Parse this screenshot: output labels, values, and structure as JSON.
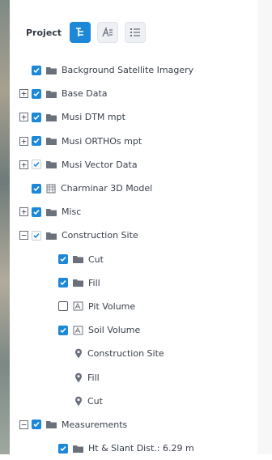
{
  "toolbar": {
    "title": "Project",
    "buttons": [
      {
        "icon": "layer-tree-icon",
        "active": true
      },
      {
        "icon": "legend-icon",
        "active": false
      },
      {
        "icon": "list-icon",
        "active": false
      }
    ]
  },
  "colors": {
    "accent": "#1e88d8",
    "folder": "#6b717b",
    "text": "#3a404b"
  },
  "tree": [
    {
      "label": "Background Satellite Imagery"
    },
    {
      "label": "Base Data"
    },
    {
      "label": "Musi DTM mpt"
    },
    {
      "label": "Musi ORTHOs mpt"
    },
    {
      "label": "Musi Vector Data"
    },
    {
      "label": "Charminar 3D Model"
    },
    {
      "label": "Misc"
    },
    {
      "label": "Construction Site"
    },
    {
      "label": "Cut"
    },
    {
      "label": "Fill"
    },
    {
      "label": "Pit Volume"
    },
    {
      "label": "Soil Volume"
    },
    {
      "label": "Construction Site"
    },
    {
      "label": "Fill"
    },
    {
      "label": "Cut"
    },
    {
      "label": "Measurements"
    },
    {
      "label": "Ht & Slant Dist.: 6.29 m"
    }
  ]
}
